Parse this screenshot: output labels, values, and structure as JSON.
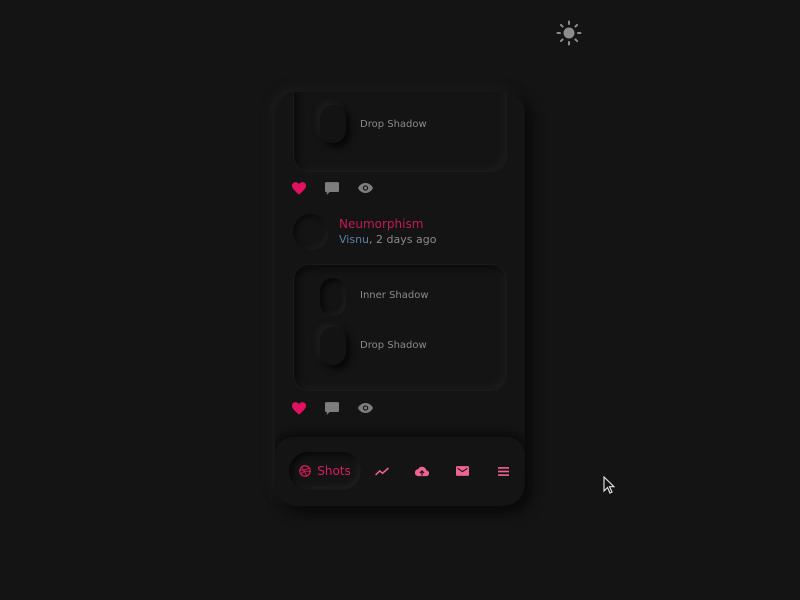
{
  "theme_toggle": {
    "icon": "sun-icon"
  },
  "colors": {
    "accent": "#d81b60",
    "author": "#5c7fa8",
    "muted": "#8a8a8a",
    "background": "#141414"
  },
  "feed": {
    "posts": [
      {
        "card_items": [
          {
            "label": "Drop Shadow",
            "style": "drop"
          }
        ],
        "actions": {
          "like": "heart-icon",
          "comment": "comment-icon",
          "view": "eye-icon"
        }
      },
      {
        "title": "Neumorphism",
        "author": "Visnu",
        "time": ", 2 days ago",
        "card_items": [
          {
            "label": "Inner Shadow",
            "style": "inner"
          },
          {
            "label": "Drop Shadow",
            "style": "drop"
          }
        ],
        "actions": {
          "like": "heart-icon",
          "comment": "comment-icon",
          "view": "eye-icon"
        }
      }
    ]
  },
  "navbar": {
    "active": {
      "label": "Shots",
      "icon": "dribbble-icon"
    },
    "items": [
      {
        "name": "stats",
        "icon": "trending-icon"
      },
      {
        "name": "upload",
        "icon": "cloud-upload-icon"
      },
      {
        "name": "mail",
        "icon": "mail-icon"
      },
      {
        "name": "menu",
        "icon": "menu-icon"
      }
    ]
  }
}
